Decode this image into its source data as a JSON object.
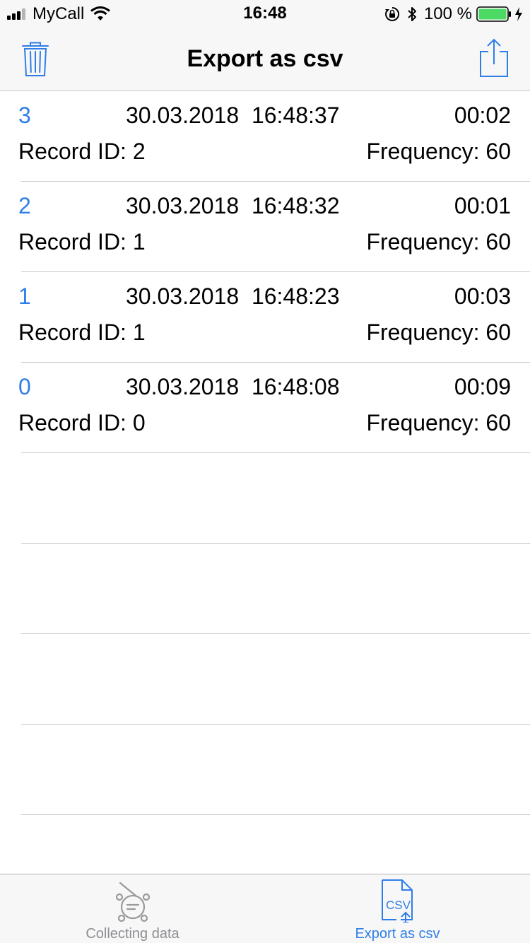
{
  "status_bar": {
    "carrier": "MyCall",
    "time": "16:48",
    "battery": "100 %",
    "battery_level": 1.0
  },
  "nav": {
    "title": "Export as csv",
    "left_icon": "trash-icon",
    "right_icon": "share-icon"
  },
  "records": [
    {
      "index": "3",
      "datetime": "30.03.2018  16:48:37",
      "duration": "00:02",
      "record_id": "Record ID: 2",
      "frequency": "Frequency: 60"
    },
    {
      "index": "2",
      "datetime": "30.03.2018  16:48:32",
      "duration": "00:01",
      "record_id": "Record ID: 1",
      "frequency": "Frequency: 60"
    },
    {
      "index": "1",
      "datetime": "30.03.2018  16:48:23",
      "duration": "00:03",
      "record_id": "Record ID: 1",
      "frequency": "Frequency: 60"
    },
    {
      "index": "0",
      "datetime": "30.03.2018  16:48:08",
      "duration": "00:09",
      "record_id": "Record ID: 0",
      "frequency": "Frequency: 60"
    }
  ],
  "tabs": [
    {
      "label": "Collecting data",
      "icon": "collecting-data-icon",
      "active": false
    },
    {
      "label": "Export as csv",
      "icon": "csv-export-icon",
      "icon_text": "CSV",
      "active": true
    }
  ],
  "colors": {
    "accent": "#2f7ee8",
    "battery": "#4cd964",
    "inactive": "#8e8e93"
  }
}
